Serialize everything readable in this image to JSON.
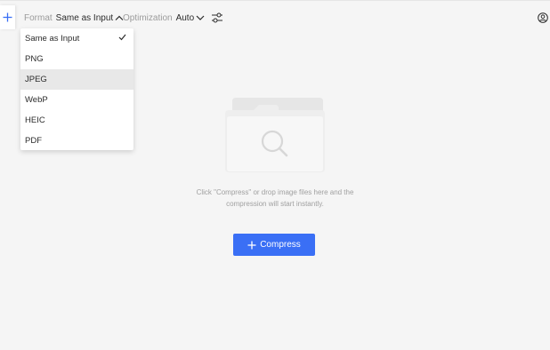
{
  "toolbar": {
    "format_label": "Format",
    "format_value": "Same as Input",
    "optimization_label": "Optimization",
    "optimization_value": "Auto"
  },
  "format_dropdown": {
    "options": [
      {
        "label": "Same as Input",
        "selected": true
      },
      {
        "label": "PNG"
      },
      {
        "label": "JPEG",
        "highlighted": true
      },
      {
        "label": "WebP"
      },
      {
        "label": "HEIC"
      },
      {
        "label": "PDF"
      }
    ]
  },
  "empty_state": {
    "hint_line1": "Click \"Compress\" or drop image files here and the",
    "hint_line2": "compression will start instantly."
  },
  "compress_button": {
    "label": "Compress"
  },
  "icons": {
    "add": "plus-icon",
    "format_caret": "chevron-up-icon",
    "optimization_caret": "chevron-down-icon",
    "settings": "sliders-icon",
    "account": "user-circle-icon",
    "check": "check-icon",
    "illustration": "folder-search-icon",
    "compress": "plus-icon"
  },
  "colors": {
    "accent": "#3a6ff5",
    "background": "#f5f5f5",
    "highlight": "#e8e8e8"
  }
}
